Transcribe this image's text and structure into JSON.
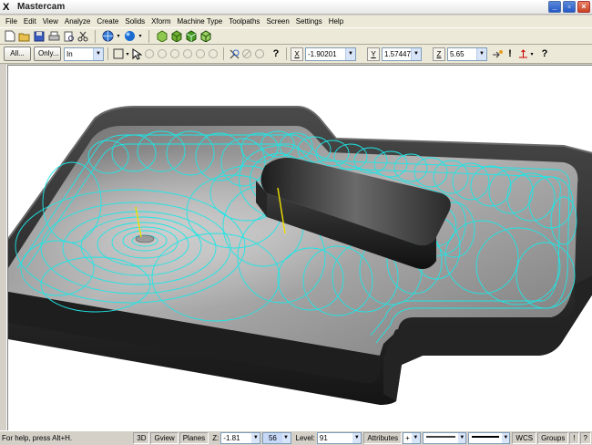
{
  "window": {
    "title": "Mastercam",
    "app_icon": "X",
    "minimize": "_",
    "maximize": "▫",
    "close": "×"
  },
  "menu": [
    "File",
    "Edit",
    "View",
    "Analyze",
    "Create",
    "Solids",
    "Xform",
    "Machine Type",
    "Toolpaths",
    "Screen",
    "Settings",
    "Help"
  ],
  "selection_bar": {
    "all_label": "All...",
    "only_label": "Only...",
    "mode_value": "In",
    "x_label": "X",
    "x_value": "-1.90201",
    "y_label": "Y",
    "y_value": "1.57447",
    "z_label": "Z",
    "z_value": "5.65",
    "help_glyph": "?"
  },
  "status": {
    "help_text": "For help, press Alt+H.",
    "mode_3d": "3D",
    "gview": "Gview",
    "planes": "Planes",
    "z_label": "Z:",
    "z_value": "-1.81",
    "color_value": "56",
    "level_label": "Level:",
    "level_value": "91",
    "attributes": "Attributes",
    "wcs": "WCS",
    "groups": "Groups",
    "info": "!",
    "help": "?"
  },
  "colors": {
    "toolpath": "#1ee6e6",
    "part_dark": "#2a2a2a",
    "part_floor": "#8c8c8c",
    "highlight_axis": "#f0e000"
  }
}
